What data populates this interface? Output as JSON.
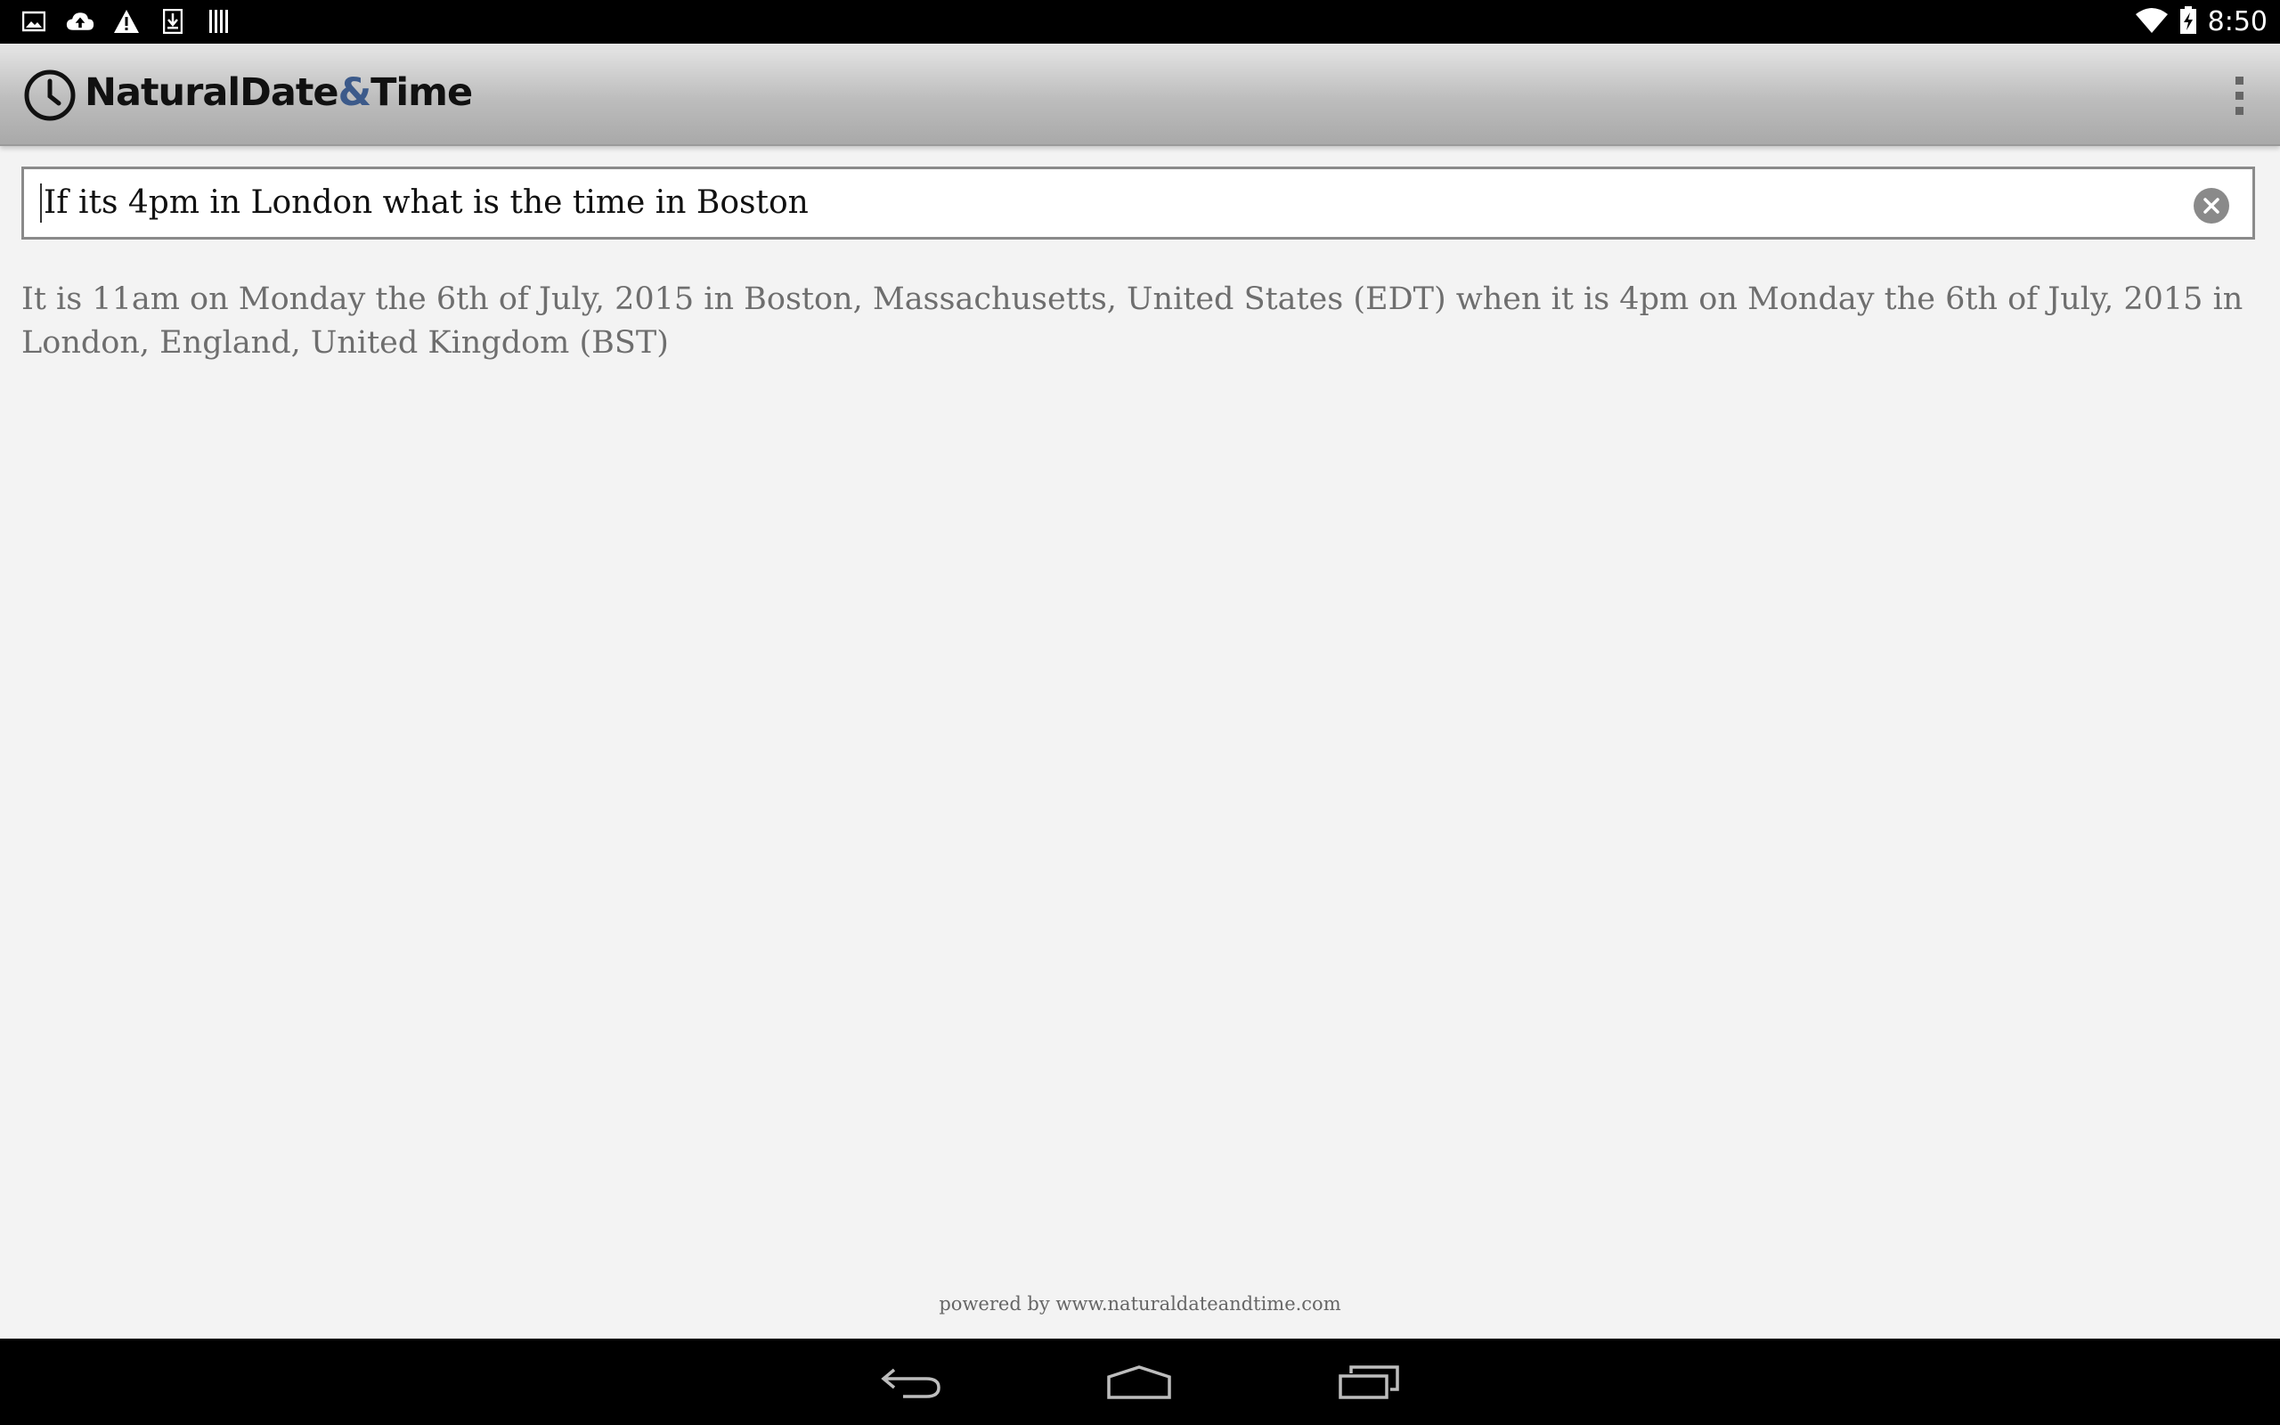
{
  "status_bar": {
    "time": "8:50",
    "left_icons": [
      "image-icon",
      "cloud-upload-icon",
      "warning-icon",
      "download-icon",
      "barcode-icon"
    ],
    "right_icons": [
      "wifi-icon",
      "battery-charging-icon"
    ]
  },
  "action_bar": {
    "title_part1": "NaturalDate",
    "title_amp": "&",
    "title_part2": "Time",
    "logo_icon": "clock-icon",
    "menu_icon": "overflow-menu-icon"
  },
  "query": {
    "value": "If its 4pm in London what is the time in Boston",
    "clear_icon": "clear-icon"
  },
  "result": {
    "text": "It is 11am on Monday the 6th of July, 2015 in Boston, Massachusetts, United States (EDT) when it is 4pm on Monday the 6th of July, 2015 in London, England, United Kingdom (BST)"
  },
  "footer": {
    "powered_by": "powered by www.naturaldateandtime.com"
  },
  "nav_bar": {
    "icons": [
      "back-icon",
      "home-icon",
      "recent-apps-icon"
    ]
  },
  "colors": {
    "accent_amp": "#3c5a8a",
    "result_text": "#6e6e6e",
    "background": "#f3f3f3"
  }
}
